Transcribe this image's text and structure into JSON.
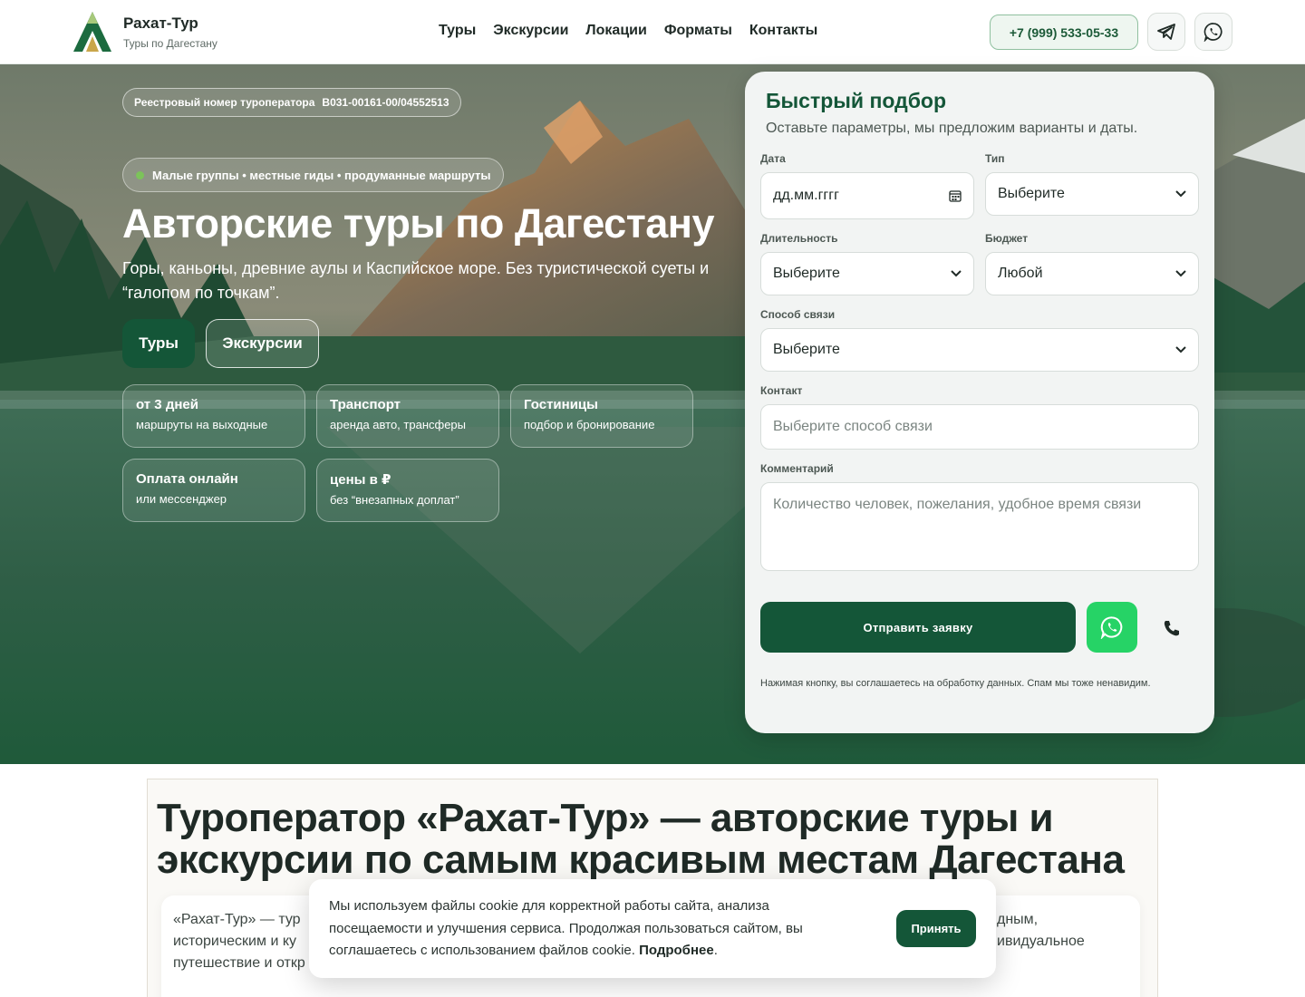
{
  "header": {
    "brand_name": "Рахат-Тур",
    "brand_sub": "Туры по Дагестану",
    "nav": [
      "Туры",
      "Экскурсии",
      "Локации",
      "Форматы",
      "Контакты"
    ],
    "phone": "+7 (999) 533-05-33",
    "telegram_icon": "telegram-icon",
    "whatsapp_icon": "whatsapp-icon"
  },
  "hero": {
    "registry_label": "Реестровый номер туроператора",
    "registry_number": "В031-00161-00/04552513",
    "tagline": "Малые группы • местные гиды • продуманные маршруты",
    "title": "Авторские туры по Дагестану",
    "subtitle": "Горы, каньоны, древние аулы и Каспийское море. Без туристической суеты и “галопом по точкам”.",
    "btn_tours": "Туры",
    "btn_excursions": "Экскурсии",
    "features": [
      {
        "title": "от 3 дней",
        "sub": "маршруты на выходные"
      },
      {
        "title": "Транспорт",
        "sub": "аренда авто, трансферы"
      },
      {
        "title": "Гостиницы",
        "sub": "подбор и бронирование"
      },
      {
        "title": "Оплата онлайн",
        "sub": "или мессенджер"
      },
      {
        "title": "цены в ₽",
        "sub": "без “внезапных доплат”"
      }
    ]
  },
  "form": {
    "title": "Быстрый подбор",
    "subtitle": "Оставьте параметры, мы предложим варианты и даты.",
    "date_label": "Дата",
    "date_placeholder": "дд.мм.гггг",
    "type_label": "Тип",
    "type_value": "Выберите",
    "duration_label": "Длительность",
    "duration_value": "Выберите",
    "budget_label": "Бюджет",
    "budget_value": "Любой",
    "contact_method_label": "Способ связи",
    "contact_method_value": "Выберите",
    "contact_label": "Контакт",
    "contact_placeholder": "Выберите способ связи",
    "comment_label": "Комментарий",
    "comment_placeholder": "Количество человек, пожелания, удобное время связи",
    "submit": "Отправить заявку",
    "consent": "Нажимая кнопку, вы соглашаетесь на обработку данных. Спам мы тоже ненавидим."
  },
  "about": {
    "title": "Туроператор «Рахат-Тур» — авторские туры и экскурсии по самым красивым местам Дагестана",
    "text_left_1": "«Рахат-Тур» — тур",
    "text_left_2": "историческим и ку",
    "text_left_3": "путешествие и откр",
    "text_right_1": "дным,",
    "text_right_2": "ивидуальное"
  },
  "cookie": {
    "text": "Мы используем файлы cookie для корректной работы сайта, анализа посещаемости и улучшения сервиса. Продолжая пользоваться сайтом, вы соглашаетесь с использованием файлов cookie.",
    "more": "Подробнее",
    "accept": "Принять"
  },
  "colors": {
    "brand_green": "#145638",
    "whatsapp_green": "#26d366",
    "accent_title": "#145638"
  }
}
